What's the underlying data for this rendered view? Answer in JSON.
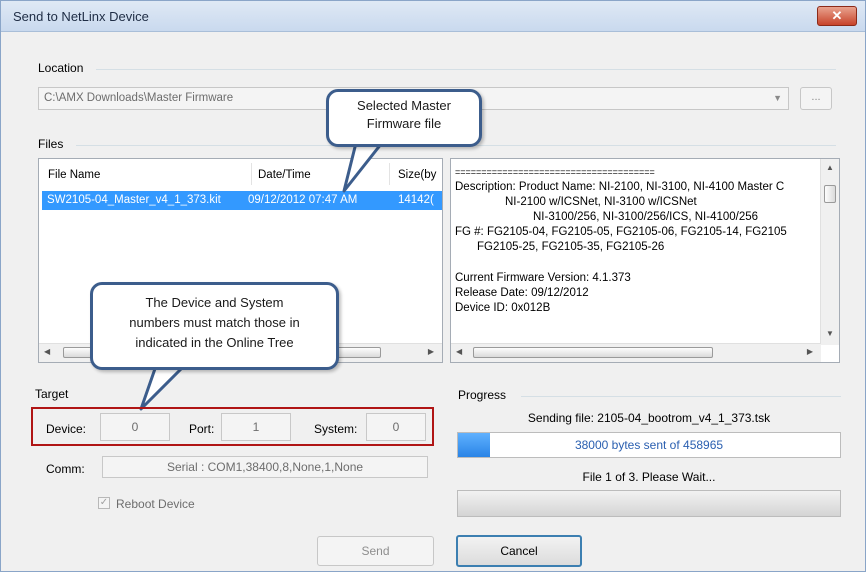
{
  "window": {
    "title": "Send to NetLinx Device",
    "close_glyph": "✕"
  },
  "location": {
    "label": "Location",
    "value": "C:\\AMX Downloads\\Master Firmware",
    "browse_label": "..."
  },
  "files": {
    "label": "Files",
    "columns": [
      "File Name",
      "Date/Time",
      "Size(by"
    ],
    "selected_row": {
      "name": "SW2105-04_Master_v4_1_373.kit",
      "datetime": "09/12/2012  07:47 AM",
      "size": "14142("
    },
    "description_lines": [
      "======================================",
      "Description: Product Name: NI-2100, NI-3100, NI-4100 Master C",
      "NI-2100 w/ICSNet, NI-3100 w/ICSNet",
      "NI-3100/256, NI-3100/256/ICS, NI-4100/256",
      "FG #: FG2105-04, FG2105-05, FG2105-06, FG2105-14, FG2105",
      "FG2105-25, FG2105-35, FG2105-26",
      "Current Firmware Version: 4.1.373",
      "Release Date: 09/12/2012",
      "Device ID: 0x012B"
    ]
  },
  "callouts": {
    "firmware": [
      "Selected Master",
      "Firmware file"
    ],
    "device": [
      "The Device and System",
      "numbers must match those in",
      "indicated in the Online Tree"
    ]
  },
  "target": {
    "label": "Target",
    "device_label": "Device:",
    "device_value": "0",
    "port_label": "Port:",
    "port_value": "1",
    "system_label": "System:",
    "system_value": "0",
    "comm_label": "Comm:",
    "comm_value": "Serial : COM1,38400,8,None,1,None",
    "reboot_label": "Reboot Device"
  },
  "progress": {
    "label": "Progress",
    "sending_text": "Sending file: 2105-04_bootrom_v4_1_373.tsk",
    "bytes_text": "38000 bytes sent of  458965",
    "fraction": 0.083,
    "file_text": "File 1 of 3.  Please Wait..."
  },
  "buttons": {
    "send": "Send",
    "cancel": "Cancel"
  },
  "colors": {
    "accent": "#3399ff",
    "callout_border": "#3c5d8c",
    "highlight_box": "#b01515"
  }
}
